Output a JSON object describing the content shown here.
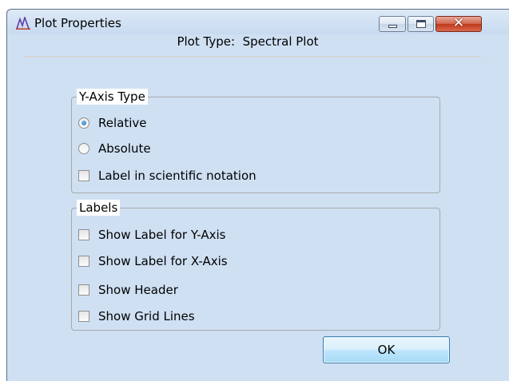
{
  "window": {
    "title": "Plot Properties",
    "app_icon": "spectrum-icon",
    "controls": {
      "minimize": "minimize-icon",
      "maximize": "maximize-icon",
      "close": "✕"
    }
  },
  "plot_type": {
    "label": "Plot Type:",
    "value": "Spectral Plot"
  },
  "y_axis_group": {
    "title": "Y-Axis Type",
    "options": [
      {
        "label": "Relative",
        "kind": "radio",
        "checked": true
      },
      {
        "label": "Absolute",
        "kind": "radio",
        "checked": false
      },
      {
        "label": "Label in scientific notation",
        "kind": "checkbox",
        "checked": false
      }
    ]
  },
  "labels_group": {
    "title": "Labels",
    "options": [
      {
        "label": "Show Label for Y-Axis",
        "checked": false
      },
      {
        "label": "Show Label for X-Axis",
        "checked": false
      },
      {
        "label": "Show Header",
        "checked": false
      },
      {
        "label": "Show Grid Lines",
        "checked": false
      }
    ]
  },
  "ok_button": {
    "label": "OK"
  }
}
